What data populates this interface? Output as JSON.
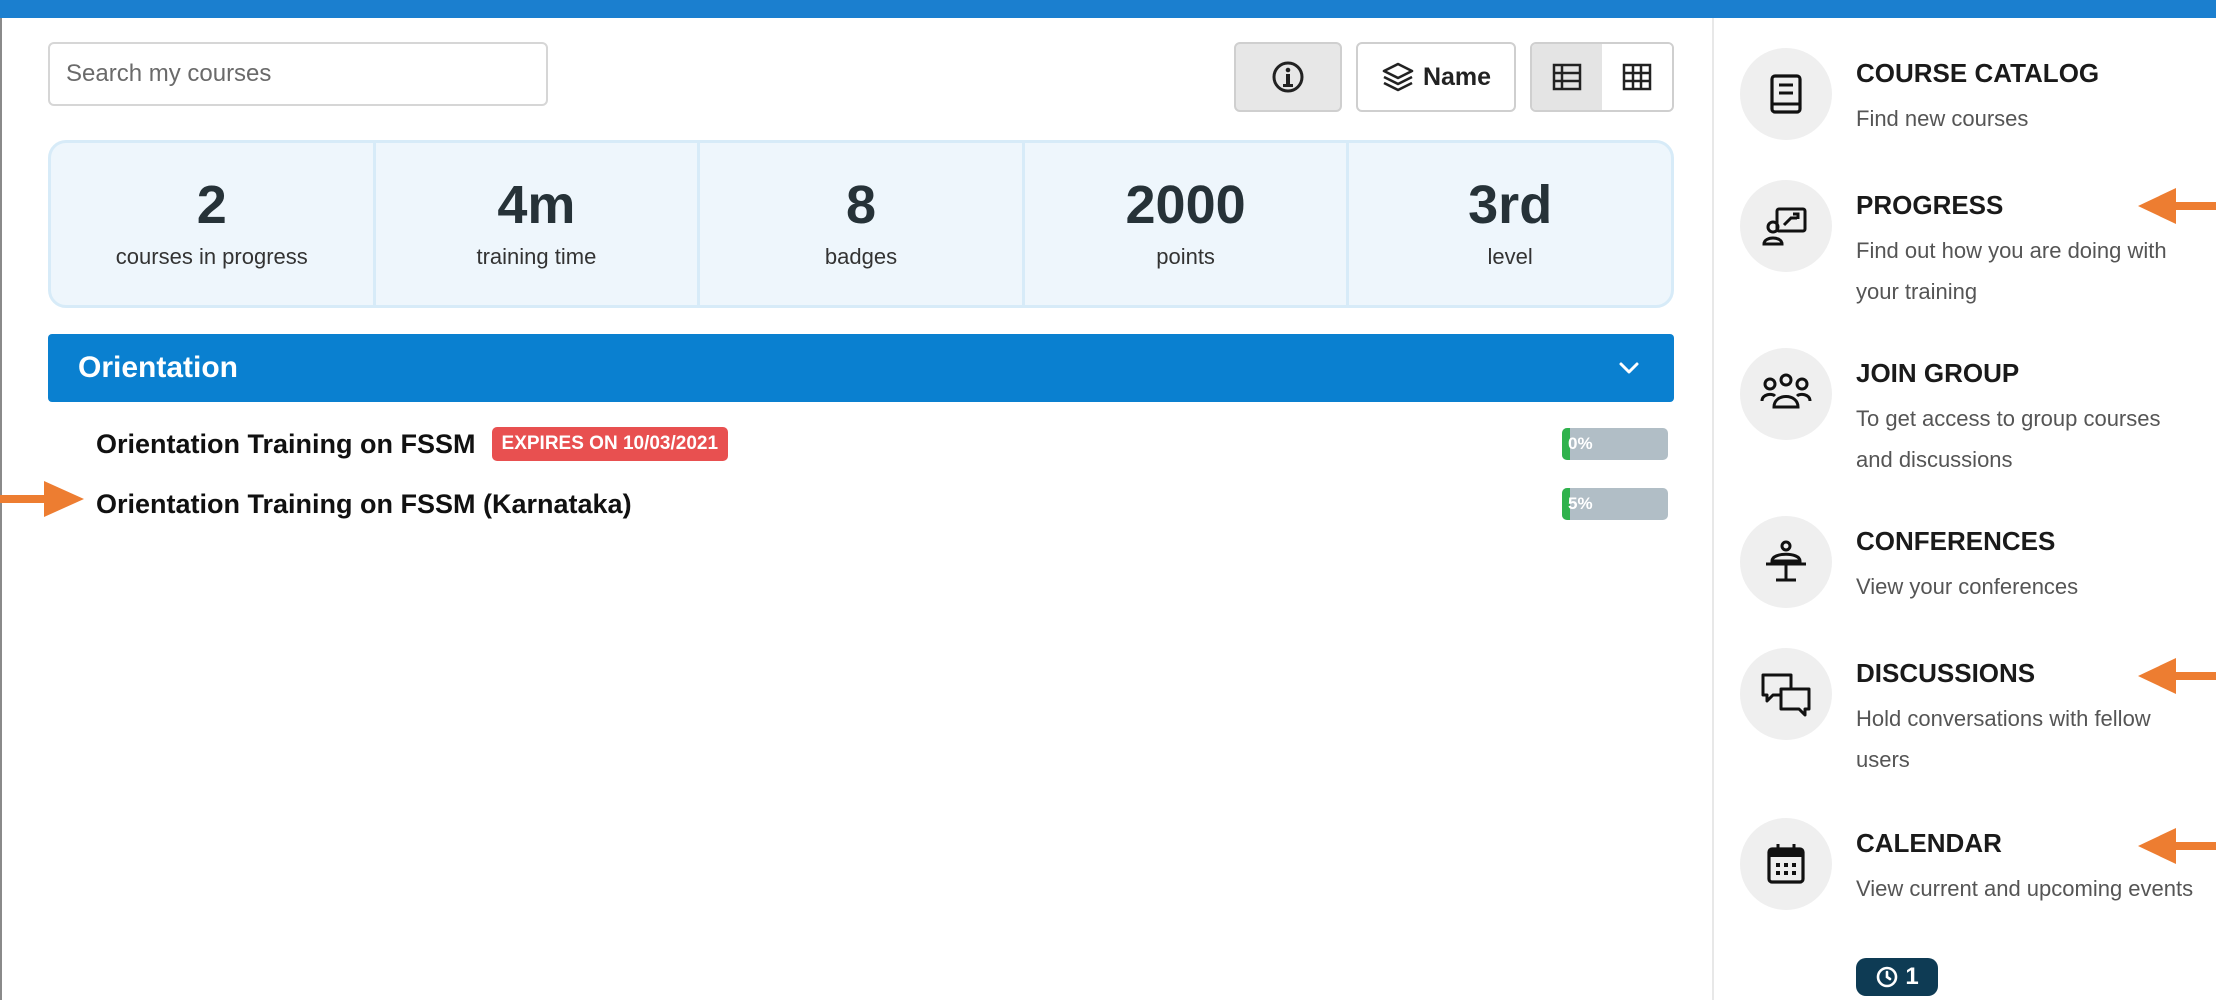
{
  "search": {
    "placeholder": "Search my courses"
  },
  "toolbar": {
    "sort_label": "Name"
  },
  "stats": [
    {
      "value": "2",
      "label": "courses in progress"
    },
    {
      "value": "4m",
      "label": "training time"
    },
    {
      "value": "8",
      "label": "badges"
    },
    {
      "value": "2000",
      "label": "points"
    },
    {
      "value": "3rd",
      "label": "level"
    }
  ],
  "category": {
    "title": "Orientation"
  },
  "courses": [
    {
      "title": "Orientation Training on FSSM",
      "expires": "EXPIRES ON 10/03/2021",
      "progress_label": "0%",
      "progress": 0
    },
    {
      "title": "Orientation Training on FSSM (Karnataka)",
      "expires": "",
      "progress_label": "5%",
      "progress": 5
    }
  ],
  "sidebar": {
    "items": [
      {
        "title": "COURSE CATALOG",
        "desc": "Find new courses",
        "icon": "book-icon"
      },
      {
        "title": "PROGRESS",
        "desc": "Find out how you are doing with your training",
        "icon": "progress-chart-icon"
      },
      {
        "title": "JOIN GROUP",
        "desc": "To get access to group courses and discussions",
        "icon": "group-icon"
      },
      {
        "title": "CONFERENCES",
        "desc": "View your conferences",
        "icon": "conference-icon"
      },
      {
        "title": "DISCUSSIONS",
        "desc": "Hold conversations with fellow users",
        "icon": "chat-bubbles-icon"
      },
      {
        "title": "CALENDAR",
        "desc": "View current and upcoming events",
        "icon": "calendar-icon",
        "badge": "1"
      }
    ]
  },
  "colors": {
    "accent": "#0a80d0",
    "expire": "#e85050",
    "progress": "#2fb24c",
    "annotation_arrow": "#ed7d31"
  }
}
